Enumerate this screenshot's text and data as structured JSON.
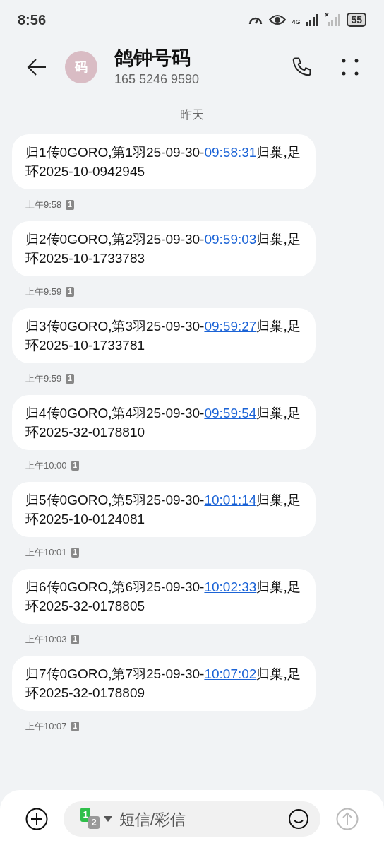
{
  "status_bar": {
    "time": "8:56",
    "network": "4G",
    "battery": "55"
  },
  "header": {
    "avatar": "码",
    "name": "鸽钟号码",
    "number": "165 5246 9590"
  },
  "date_label": "昨天",
  "messages": [
    {
      "pre": "归1传0GORO,第1羽25-09-30-",
      "link": "09:58:31",
      "post": "归巢,足环2025-10-0942945",
      "time": "上午9:58",
      "sim": "1"
    },
    {
      "pre": "归2传0GORO,第2羽25-09-30-",
      "link": "09:59:03",
      "post": "归巢,足环2025-10-1733783",
      "time": "上午9:59",
      "sim": "1"
    },
    {
      "pre": "归3传0GORO,第3羽25-09-30-",
      "link": "09:59:27",
      "post": "归巢,足环2025-10-1733781",
      "time": "上午9:59",
      "sim": "1"
    },
    {
      "pre": "归4传0GORO,第4羽25-09-30-",
      "link": "09:59:54",
      "post": "归巢,足环2025-32-0178810",
      "time": "上午10:00",
      "sim": "1"
    },
    {
      "pre": "归5传0GORO,第5羽25-09-30-",
      "link": "10:01:14",
      "post": "归巢,足环2025-10-0124081",
      "time": "上午10:01",
      "sim": "1"
    },
    {
      "pre": "归6传0GORO,第6羽25-09-30-",
      "link": "10:02:33",
      "post": "归巢,足环2025-32-0178805",
      "time": "上午10:03",
      "sim": "1"
    },
    {
      "pre": "归7传0GORO,第7羽25-09-30-",
      "link": "10:07:02",
      "post": "归巢,足环2025-32-0178809",
      "time": "上午10:07",
      "sim": "1"
    }
  ],
  "composer": {
    "sim_primary": "1",
    "sim_secondary": "2",
    "placeholder": "短信/彩信"
  }
}
